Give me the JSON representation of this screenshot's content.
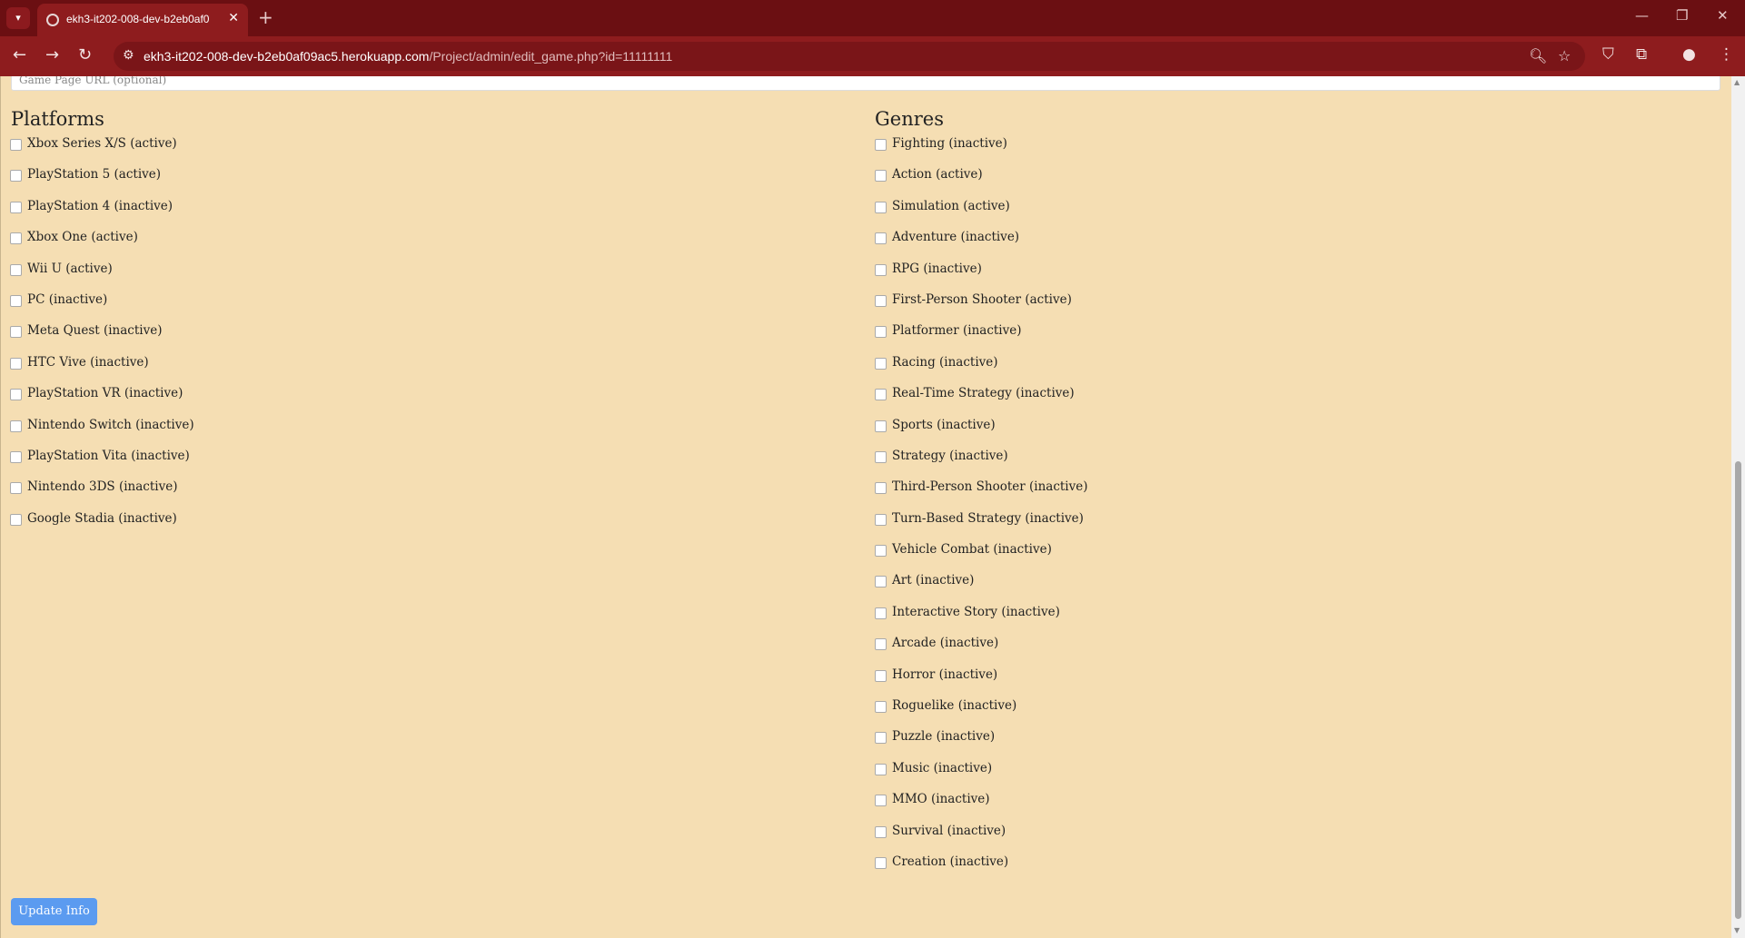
{
  "browser": {
    "tab_title": "ekh3-it202-008-dev-b2eb0af0",
    "url_host": "ekh3-it202-008-dev-b2eb0af09ac5.herokuapp.com",
    "url_path": "/Project/admin/edit_game.php?id=11111111"
  },
  "form": {
    "url_placeholder": "Game Page URL (optional)",
    "platforms_title": "Platforms",
    "genres_title": "Genres",
    "platforms": [
      "Xbox Series X/S (active)",
      "PlayStation 5 (active)",
      "PlayStation 4 (inactive)",
      "Xbox One (active)",
      "Wii U (active)",
      "PC (inactive)",
      "Meta Quest (inactive)",
      "HTC Vive (inactive)",
      "PlayStation VR (inactive)",
      "Nintendo Switch (inactive)",
      "PlayStation Vita (inactive)",
      "Nintendo 3DS (inactive)",
      "Google Stadia (inactive)"
    ],
    "genres": [
      "Fighting (inactive)",
      "Action (active)",
      "Simulation (active)",
      "Adventure (inactive)",
      "RPG (inactive)",
      "First-Person Shooter (active)",
      "Platformer (inactive)",
      "Racing (inactive)",
      "Real-Time Strategy (inactive)",
      "Sports (inactive)",
      "Strategy (inactive)",
      "Third-Person Shooter (inactive)",
      "Turn-Based Strategy (inactive)",
      "Vehicle Combat (inactive)",
      "Art (inactive)",
      "Interactive Story (inactive)",
      "Arcade (inactive)",
      "Horror (inactive)",
      "Roguelike (inactive)",
      "Puzzle (inactive)",
      "Music (inactive)",
      "MMO (inactive)",
      "Survival (inactive)",
      "Creation (inactive)"
    ],
    "submit_label": "Update Info"
  },
  "colors": {
    "page_bg": "#f5deb3",
    "chrome_bg": "#6b0f12",
    "toolbar_bg": "#8e1c1e",
    "button_bg": "#5b9bf0"
  }
}
